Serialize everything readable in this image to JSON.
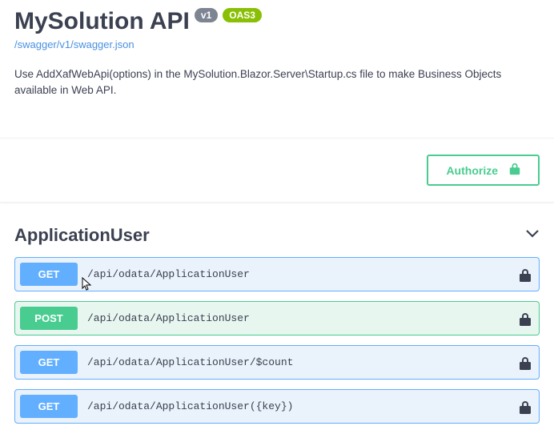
{
  "header": {
    "title": "MySolution API",
    "version": "v1",
    "oas": "OAS3",
    "spec_link": "/swagger/v1/swagger.json",
    "description": "Use AddXafWebApi(options) in the MySolution.Blazor.Server\\Startup.cs file to make Business Objects available in Web API."
  },
  "scheme": {
    "authorize_label": "Authorize"
  },
  "tag": {
    "name": "ApplicationUser"
  },
  "operations": [
    {
      "method": "GET",
      "style": "get",
      "path": "/api/odata/ApplicationUser",
      "cursor": true
    },
    {
      "method": "POST",
      "style": "post",
      "path": "/api/odata/ApplicationUser",
      "cursor": false
    },
    {
      "method": "GET",
      "style": "get",
      "path": "/api/odata/ApplicationUser/$count",
      "cursor": false
    },
    {
      "method": "GET",
      "style": "get",
      "path": "/api/odata/ApplicationUser({key})",
      "cursor": false
    }
  ]
}
